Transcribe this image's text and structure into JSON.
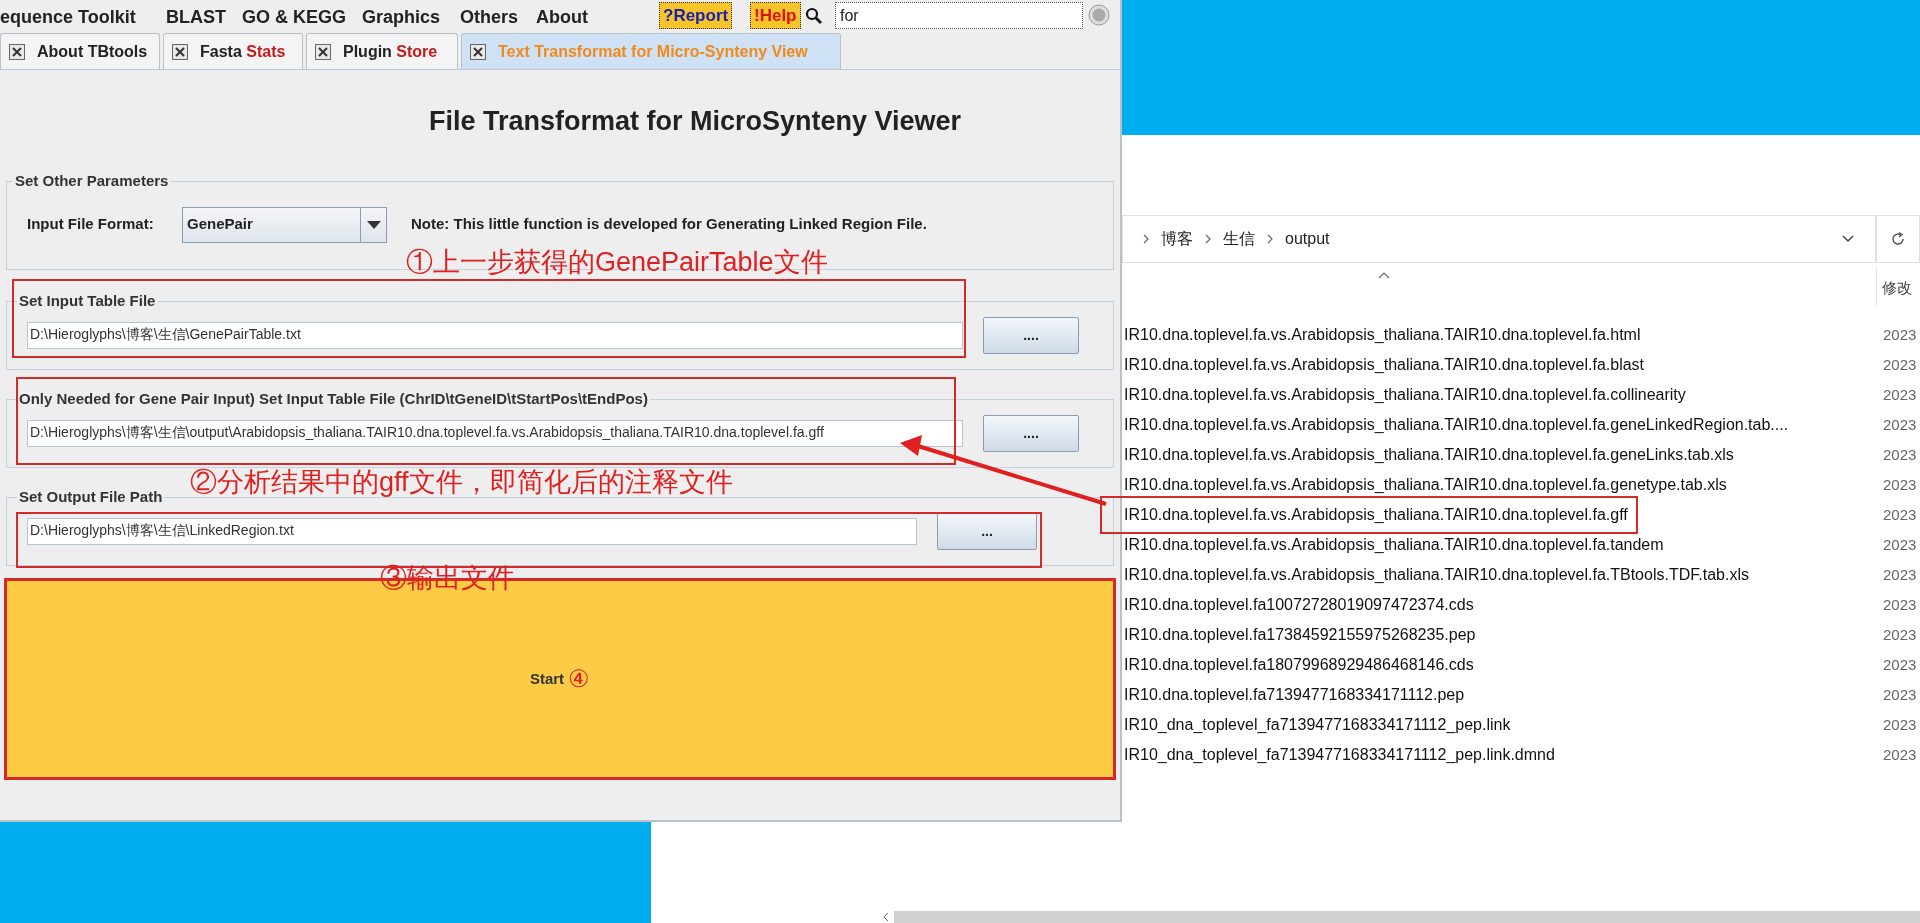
{
  "menu_bar": {
    "items": [
      "equence Toolkit",
      "BLAST",
      "GO & KEGG",
      "Graphics",
      "Others",
      "About"
    ],
    "report_button": "?Report",
    "help_button": "!Help",
    "search": {
      "value": "for"
    }
  },
  "tabs": [
    {
      "title": "About TBtools",
      "selected": false
    },
    {
      "title": "Fasta",
      "accent": "Stats",
      "selected": false
    },
    {
      "title": "Plugin",
      "accent": "Store",
      "selected": false
    },
    {
      "title": "Text Transformat for Micro-Synteny View",
      "selected": true
    }
  ],
  "heading": "File Transformat for MicroSynteny Viewer",
  "parameters": {
    "legend": "Set Other Parameters",
    "format_label": "Input File Format:",
    "format_value": "GenePair",
    "note": "Note: This little function is developed for Generating Linked Region File."
  },
  "file_sections": [
    {
      "legend": "Set Input Table File",
      "value": "D:\\Hieroglyphs\\博客\\生信\\GenePairTable.txt",
      "button": "...."
    },
    {
      "legend": "Only Needed for Gene Pair Input) Set Input Table File (ChrID\\tGeneID\\tStartPos\\tEndPos)",
      "value": "D:\\Hieroglyphs\\博客\\生信\\output\\Arabidopsis_thaliana.TAIR10.dna.toplevel.fa.vs.Arabidopsis_thaliana.TAIR10.dna.toplevel.fa.gff",
      "button": "...."
    },
    {
      "legend": "Set Output File Path",
      "value": "D:\\Hieroglyphs\\博客\\生信\\LinkedRegion.txt",
      "button": "..."
    }
  ],
  "start_button": {
    "label": "Start",
    "mark": "④"
  },
  "annotations": [
    "①上一步获得的GenePairTable文件",
    "②分析结果中的gff文件，即简化后的注释文件",
    "③输出文件"
  ],
  "explorer": {
    "breadcrumb": [
      "博客",
      "生信",
      "output"
    ],
    "column_header": "修改",
    "files": [
      {
        "name": "IR10.dna.toplevel.fa.vs.Arabidopsis_thaliana.TAIR10.dna.toplevel.fa.html",
        "date": "2023",
        "highlighted": false
      },
      {
        "name": "IR10.dna.toplevel.fa.vs.Arabidopsis_thaliana.TAIR10.dna.toplevel.fa.blast",
        "date": "2023",
        "highlighted": false
      },
      {
        "name": "IR10.dna.toplevel.fa.vs.Arabidopsis_thaliana.TAIR10.dna.toplevel.fa.collinearity",
        "date": "2023",
        "highlighted": false
      },
      {
        "name": "IR10.dna.toplevel.fa.vs.Arabidopsis_thaliana.TAIR10.dna.toplevel.fa.geneLinkedRegion.tab....",
        "date": "2023",
        "highlighted": false
      },
      {
        "name": "IR10.dna.toplevel.fa.vs.Arabidopsis_thaliana.TAIR10.dna.toplevel.fa.geneLinks.tab.xls",
        "date": "2023",
        "highlighted": false
      },
      {
        "name": "IR10.dna.toplevel.fa.vs.Arabidopsis_thaliana.TAIR10.dna.toplevel.fa.genetype.tab.xls",
        "date": "2023",
        "highlighted": false
      },
      {
        "name": "IR10.dna.toplevel.fa.vs.Arabidopsis_thaliana.TAIR10.dna.toplevel.fa.gff",
        "date": "2023",
        "highlighted": true
      },
      {
        "name": "IR10.dna.toplevel.fa.vs.Arabidopsis_thaliana.TAIR10.dna.toplevel.fa.tandem",
        "date": "2023",
        "highlighted": false
      },
      {
        "name": "IR10.dna.toplevel.fa.vs.Arabidopsis_thaliana.TAIR10.dna.toplevel.fa.TBtools.TDF.tab.xls",
        "date": "2023",
        "highlighted": false
      },
      {
        "name": "IR10.dna.toplevel.fa10072728019097472374.cds",
        "date": "2023",
        "highlighted": false
      },
      {
        "name": "IR10.dna.toplevel.fa17384592155975268235.pep",
        "date": "2023",
        "highlighted": false
      },
      {
        "name": "IR10.dna.toplevel.fa18079968929486468146.cds",
        "date": "2023",
        "highlighted": false
      },
      {
        "name": "IR10.dna.toplevel.fa7139477168334171112.pep",
        "date": "2023",
        "highlighted": false
      },
      {
        "name": "IR10_dna_toplevel_fa7139477168334171112_pep.link",
        "date": "2023",
        "highlighted": false
      },
      {
        "name": "IR10_dna_toplevel_fa7139477168334171112_pep.link.dmnd",
        "date": "2023",
        "highlighted": false
      }
    ]
  }
}
